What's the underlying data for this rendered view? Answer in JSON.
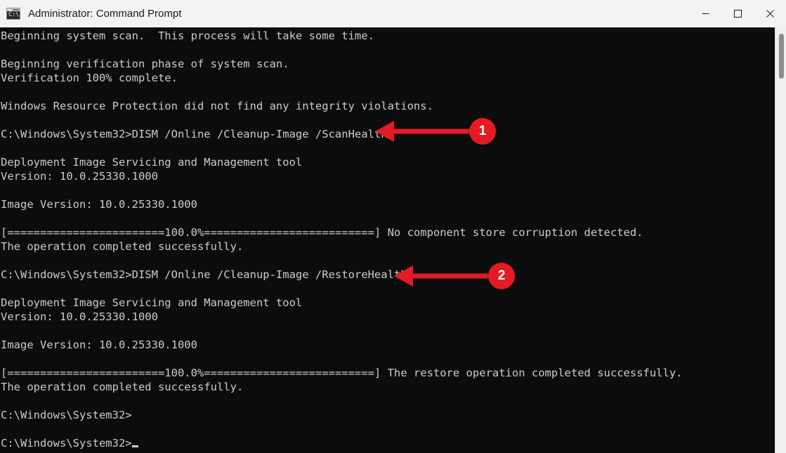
{
  "window": {
    "title": "Administrator: Command Prompt",
    "icon": "cmd-icon",
    "icon_glyph": "C:\\",
    "controls": {
      "minimize_label": "Minimize",
      "maximize_label": "Maximize",
      "close_label": "Close"
    }
  },
  "console": {
    "lines": [
      "Beginning system scan.  This process will take some time.",
      "",
      "Beginning verification phase of system scan.",
      "Verification 100% complete.",
      "",
      "Windows Resource Protection did not find any integrity violations.",
      "",
      "C:\\Windows\\System32>DISM /Online /Cleanup-Image /ScanHealth",
      "",
      "Deployment Image Servicing and Management tool",
      "Version: 10.0.25330.1000",
      "",
      "Image Version: 10.0.25330.1000",
      "",
      "[========================100.0%==========================] No component store corruption detected.",
      "The operation completed successfully.",
      "",
      "C:\\Windows\\System32>DISM /Online /Cleanup-Image /RestoreHealth",
      "",
      "Deployment Image Servicing and Management tool",
      "Version: 10.0.25330.1000",
      "",
      "Image Version: 10.0.25330.1000",
      "",
      "[========================100.0%==========================] The restore operation completed successfully.",
      "The operation completed successfully.",
      "",
      "C:\\Windows\\System32>",
      "",
      "C:\\Windows\\System32>"
    ],
    "prompt": "C:\\Windows\\System32>",
    "commands": [
      "DISM /Online /Cleanup-Image /ScanHealth",
      "DISM /Online /Cleanup-Image /RestoreHealth"
    ],
    "progress_percent": "100.0%",
    "foreground_color": "#ccccce",
    "background_color": "#0c0c0c"
  },
  "annotations": [
    {
      "number": "1",
      "points_at": "/ScanHealth",
      "color": "#e41b23"
    },
    {
      "number": "2",
      "points_at": "/RestoreHealth",
      "color": "#e41b23"
    }
  ],
  "scrollbar": {
    "orientation": "vertical",
    "thumb_position": "near-top"
  }
}
